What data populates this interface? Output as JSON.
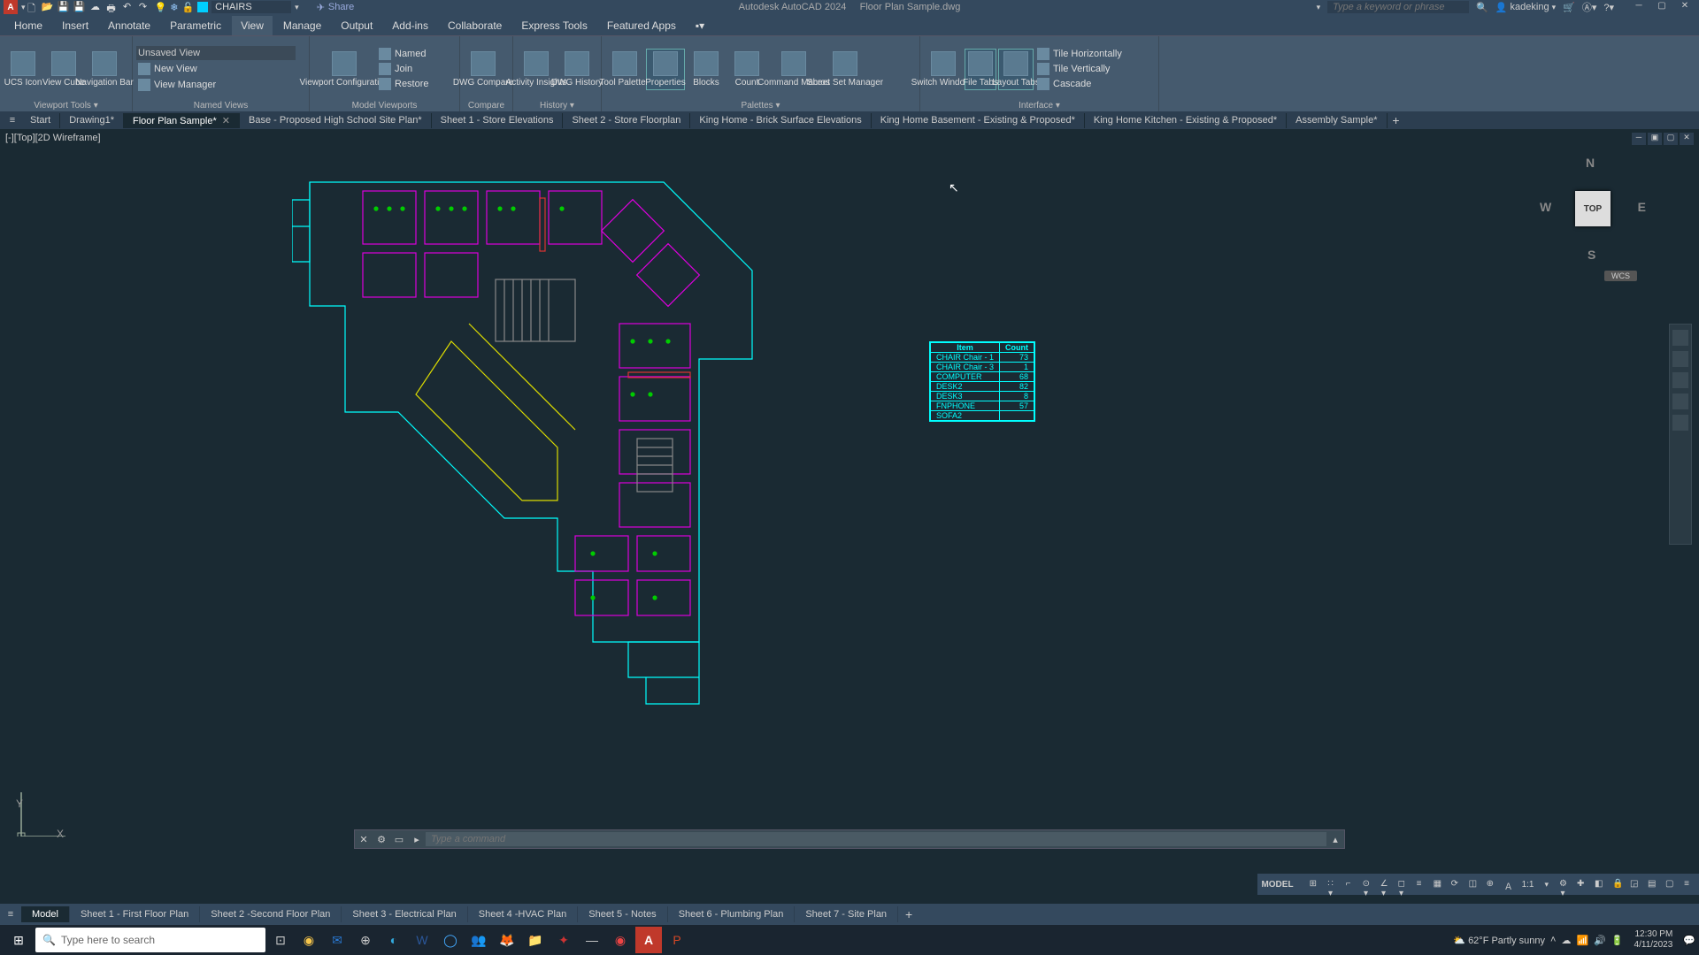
{
  "app": {
    "logo": "A",
    "title_product": "Autodesk AutoCAD 2024",
    "title_file": "Floor Plan Sample.dwg",
    "layer_current": "CHAIRS",
    "share_label": "Share",
    "search_placeholder": "Type a keyword or phrase",
    "username": "kadeking"
  },
  "menu": {
    "items": [
      "Home",
      "Insert",
      "Annotate",
      "Parametric",
      "View",
      "Manage",
      "Output",
      "Add-ins",
      "Collaborate",
      "Express Tools",
      "Featured Apps"
    ],
    "active": "View"
  },
  "ribbon": {
    "viewport_tools": {
      "ucs_icon": "UCS\nIcon",
      "view_cube": "View\nCube",
      "nav_bar": "Navigation\nBar",
      "label": "Viewport Tools ▾"
    },
    "named_views": {
      "dropdown": "Unsaved View",
      "new_view": "New View",
      "view_manager": "View Manager",
      "label": "Named Views"
    },
    "model_viewports": {
      "viewport_config": "Viewport\nConfiguration",
      "named": "Named",
      "join": "Join",
      "restore": "Restore",
      "label": "Model Viewports"
    },
    "compare": {
      "btn": "DWG\nCompare",
      "label": "Compare"
    },
    "history": {
      "insights": "Activity\nInsights",
      "dwg_history": "DWG\nHistory",
      "label": "History ▾"
    },
    "palettes": {
      "tool": "Tool\nPalettes",
      "properties": "Properties",
      "blocks": "Blocks",
      "count": "Count",
      "command_macros": "Command\nMacros",
      "sheet_set": "Sheet Set\nManager",
      "label": "Palettes ▾"
    },
    "windows": {
      "switch": "Switch\nWindows",
      "file_tabs": "File\nTabs",
      "layout_tabs": "Layout\nTabs",
      "tile_h": "Tile Horizontally",
      "tile_v": "Tile Vertically",
      "cascade": "Cascade",
      "label": "Interface ▾"
    }
  },
  "file_tabs": [
    {
      "label": "Start",
      "active": false,
      "dirty": false
    },
    {
      "label": "Drawing1",
      "active": false,
      "dirty": true
    },
    {
      "label": "Floor Plan Sample",
      "active": true,
      "dirty": true
    },
    {
      "label": "Base - Proposed High School Site Plan",
      "active": false,
      "dirty": true
    },
    {
      "label": "Sheet 1 - Store Elevations",
      "active": false,
      "dirty": false
    },
    {
      "label": "Sheet 2 - Store Floorplan",
      "active": false,
      "dirty": false
    },
    {
      "label": "King Home - Brick Surface Elevations",
      "active": false,
      "dirty": false
    },
    {
      "label": "King Home Basement - Existing & Proposed",
      "active": false,
      "dirty": true
    },
    {
      "label": "King Home Kitchen - Existing & Proposed",
      "active": false,
      "dirty": true
    },
    {
      "label": "Assembly Sample",
      "active": false,
      "dirty": true
    }
  ],
  "viewport": {
    "label": "[-][Top][2D Wireframe]",
    "viewcube_face": "TOP",
    "wcs": "WCS"
  },
  "schedule": {
    "header": [
      "Item",
      "Count"
    ],
    "rows": [
      [
        "CHAIR Chair - 1",
        "73"
      ],
      [
        "CHAIR Chair - 3",
        "1"
      ],
      [
        "COMPUTER",
        "68"
      ],
      [
        "DESK2",
        "82"
      ],
      [
        "DESK3",
        "8"
      ],
      [
        "FNPHONE",
        "57"
      ],
      [
        "SOFA2",
        ""
      ]
    ]
  },
  "cmd": {
    "placeholder": "Type a command"
  },
  "layout_tabs": {
    "items": [
      "Model",
      "Sheet 1 - First Floor Plan",
      "Sheet 2 -Second Floor Plan",
      "Sheet 3 - Electrical Plan",
      "Sheet 4 -HVAC Plan",
      "Sheet 5 - Notes",
      "Sheet 6 - Plumbing Plan",
      "Sheet 7 - Site Plan"
    ],
    "active": "Model"
  },
  "status": {
    "model": "MODEL",
    "scale": "1:1"
  },
  "taskbar": {
    "search_placeholder": "Type here to search",
    "weather": "62°F  Partly sunny",
    "time": "12:30 PM",
    "date": "4/11/2023"
  }
}
